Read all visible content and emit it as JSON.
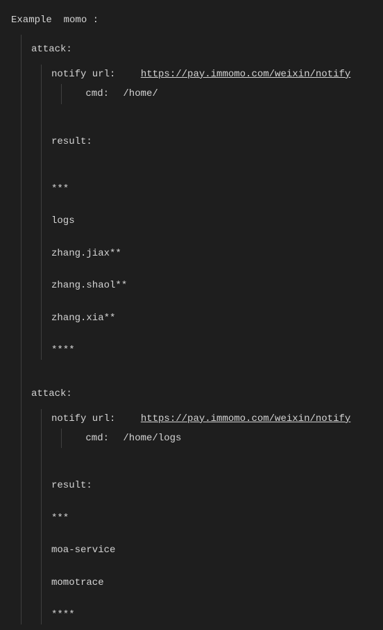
{
  "title_prefix": "Example",
  "title_name": "momo",
  "title_suffix": ":",
  "attacks": [
    {
      "heading": "attack:",
      "notify_label": "notify url:",
      "notify_url": "https://pay.immomo.com/weixin/notify",
      "cmd_label": "cmd:",
      "cmd_value": "/home/",
      "result_label": "result:",
      "lines": [
        "***",
        "logs",
        "zhang.jiax**",
        "zhang.shaol**",
        "zhang.xia**",
        "****"
      ]
    },
    {
      "heading": "attack:",
      "notify_label": "notify url:",
      "notify_url": "https://pay.immomo.com/weixin/notify",
      "cmd_label": "cmd:",
      "cmd_value": "/home/logs",
      "result_label": "result:",
      "lines": [
        "***",
        " moa-service",
        " momotrace",
        "****"
      ]
    }
  ]
}
